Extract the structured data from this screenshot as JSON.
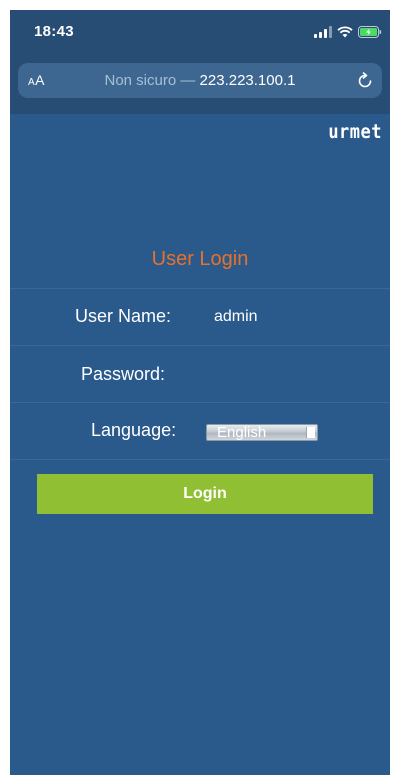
{
  "status_bar": {
    "time": "18:43",
    "icons": [
      "signal-icon",
      "wifi-icon",
      "battery-charging-icon"
    ]
  },
  "browser": {
    "text_size_small": "A",
    "text_size_large": "A",
    "url_prefix": "Non sicuro —",
    "url_host": "223.223.100.1",
    "reload_icon": "reload-icon"
  },
  "brand": {
    "logo_text": "urmet"
  },
  "login_form": {
    "title": "User Login",
    "username_label": "User Name:",
    "username_value": "admin",
    "password_label": "Password:",
    "password_value": "",
    "language_label": "Language:",
    "language_selected": "English",
    "submit_label": "Login"
  },
  "colors": {
    "page_background": "#2a5a8c",
    "title": "#e8712a",
    "login_button": "#90bf33",
    "text": "#ffffff"
  }
}
